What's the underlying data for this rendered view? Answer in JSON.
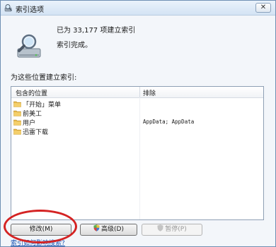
{
  "window": {
    "title": "索引选项",
    "close_label": "✕"
  },
  "status": {
    "count_text": "已为 33,177 项建立索引",
    "done_text": "索引完成。"
  },
  "section_label": "为这些位置建立索引:",
  "table": {
    "headers": [
      "包含的位置",
      "排除"
    ],
    "rows": [
      {
        "location": "「开始」菜单",
        "exclude": ""
      },
      {
        "location": "前美工",
        "exclude": ""
      },
      {
        "location": "用户",
        "exclude": "AppData; AppData"
      },
      {
        "location": "迅雷下载",
        "exclude": ""
      }
    ]
  },
  "buttons": {
    "modify": "修改(M)",
    "advanced": "高级(D)",
    "pause": "暂停(P)"
  },
  "help_link": "索引如何影响搜索?",
  "colors": {
    "annotation_oval": "#d42323",
    "link": "#1c56b4",
    "folder": "#e8b84a"
  },
  "icons": {
    "title": "search-index-icon",
    "status": "magnifier-drive-icon",
    "folder": "folder-icon",
    "shield": "uac-shield-icon"
  }
}
